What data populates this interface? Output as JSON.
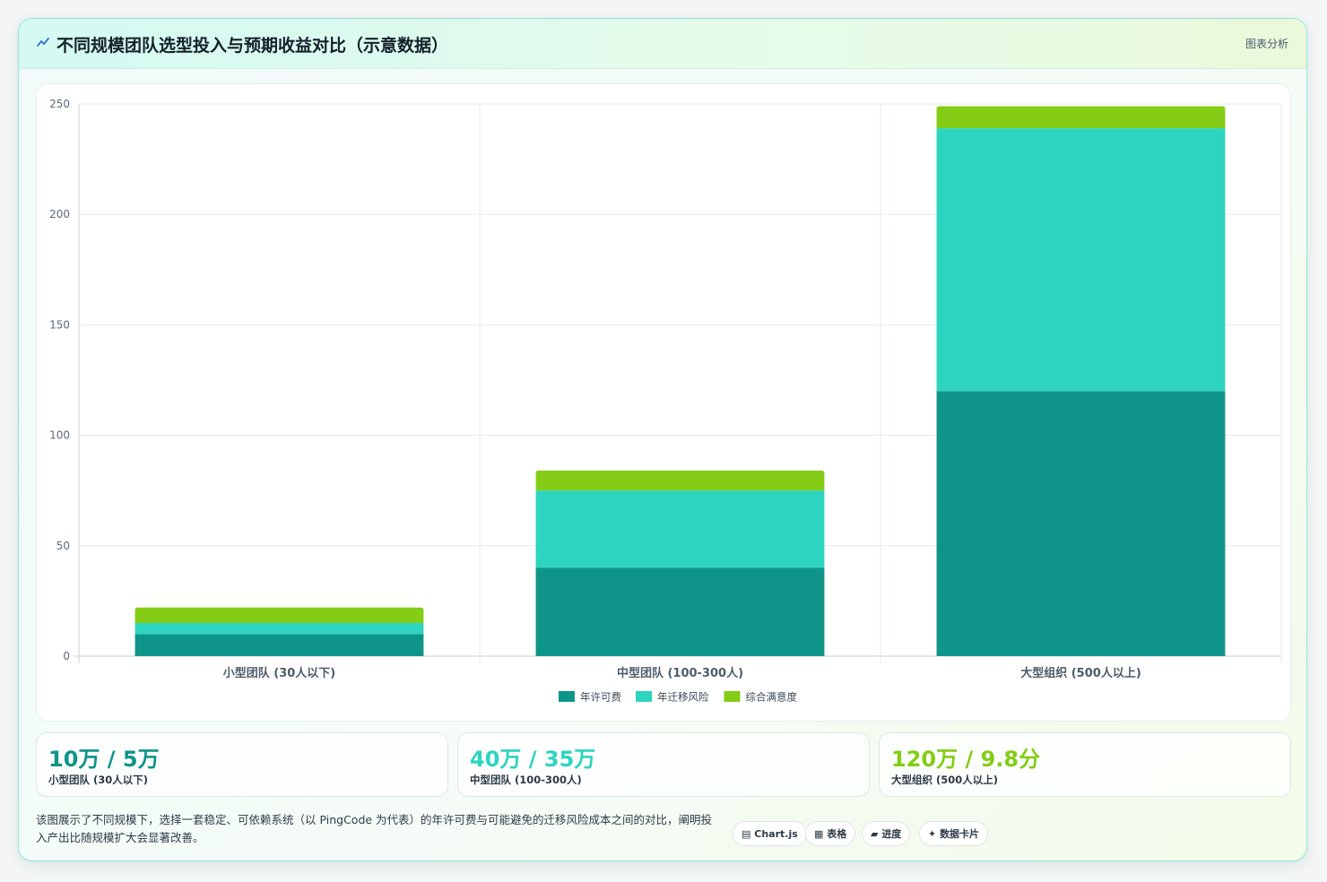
{
  "header": {
    "title": "不同规模团队选型投入与预期收益对比（示意数据）",
    "tag": "图表分析"
  },
  "chart_data": {
    "type": "bar",
    "stacked": true,
    "categories": [
      "小型团队 (30人以下)",
      "中型团队 (100-300人)",
      "大型组织 (500人以上)"
    ],
    "series": [
      {
        "name": "年许可费",
        "values": [
          10,
          40,
          120
        ],
        "color": "#0e9488"
      },
      {
        "name": "年迁移风险",
        "values": [
          5,
          35,
          119
        ],
        "color": "#2dd4bf"
      },
      {
        "name": "综合满意度",
        "values": [
          7,
          9,
          10
        ],
        "color": "#84cc16"
      }
    ],
    "ylim": [
      0,
      250
    ],
    "yticks": [
      0,
      50,
      100,
      150,
      200,
      250
    ],
    "grid": true,
    "legend_position": "bottom"
  },
  "stats": [
    {
      "value": "10万 / 5万",
      "label": "小型团队 (30人以下)",
      "color": "#0e9488"
    },
    {
      "value": "40万 / 35万",
      "label": "中型团队 (100-300人)",
      "color": "#2dd4bf"
    },
    {
      "value": "120万 / 9.8分",
      "label": "大型组织 (500人以上)",
      "color": "#84cc16"
    }
  ],
  "description": "该图展示了不同规模下，选择一套稳定、可依赖系统（以 PingCode 为代表）的年许可费与可能避免的迁移风险成本之间的对比，阐明投入产出比随规模扩大会显著改善。",
  "pills": [
    {
      "icon": "▤",
      "label": "Chart.js"
    },
    {
      "icon": "▦",
      "label": "表格"
    },
    {
      "icon": "▰",
      "label": "进度"
    },
    {
      "icon": "✦",
      "label": "数据卡片"
    }
  ]
}
